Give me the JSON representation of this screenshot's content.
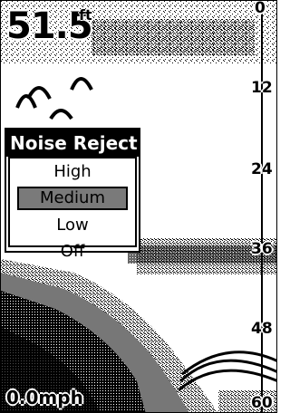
{
  "depth": {
    "value": "51.5",
    "unit": "ft"
  },
  "scale": {
    "labels": [
      "0",
      "12",
      "24",
      "36",
      "48",
      "60"
    ]
  },
  "speed": "0.0mph",
  "menu": {
    "title": "Noise Reject",
    "items": [
      {
        "label": "High"
      },
      {
        "label": "Medium",
        "selected": true
      },
      {
        "label": "Low"
      },
      {
        "label": "Off"
      }
    ]
  }
}
